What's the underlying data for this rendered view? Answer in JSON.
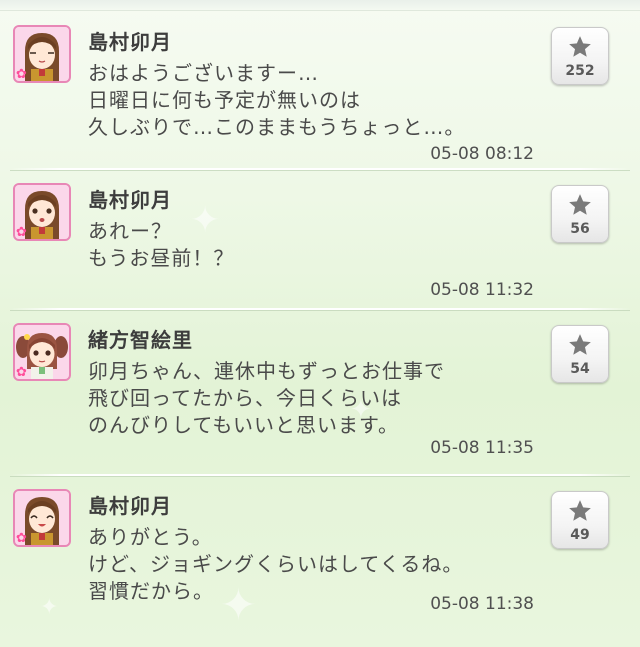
{
  "posts": [
    {
      "name": "島村卯月",
      "message": "おはようございますー…\n日曜日に何も予定が無いのは\n久しぶりで…このままもうちょっと…。",
      "time": "05-08 08:12",
      "stars": "252",
      "avatar": "uzuki"
    },
    {
      "name": "島村卯月",
      "message": "あれー？\nもうお昼前！？",
      "time": "05-08 11:32",
      "stars": "56",
      "avatar": "uzuki"
    },
    {
      "name": "緒方智絵里",
      "message": "卯月ちゃん、連休中もずっとお仕事で\n飛び回ってたから、今日くらいは\nのんびりしてもいいと思います。",
      "time": "05-08 11:35",
      "stars": "54",
      "avatar": "chieri"
    },
    {
      "name": "島村卯月",
      "message": "ありがとう。\nけど、ジョギングくらいはしてくるね。\n習慣だから。",
      "time": "05-08 11:38",
      "stars": "49",
      "avatar": "uzuki"
    }
  ],
  "icons": {
    "star": "star-icon",
    "flower": "flower-icon"
  },
  "colors": {
    "avatar_frame": "#e887b6",
    "background": "#e3f3d6",
    "star": "#7a7a7a"
  }
}
